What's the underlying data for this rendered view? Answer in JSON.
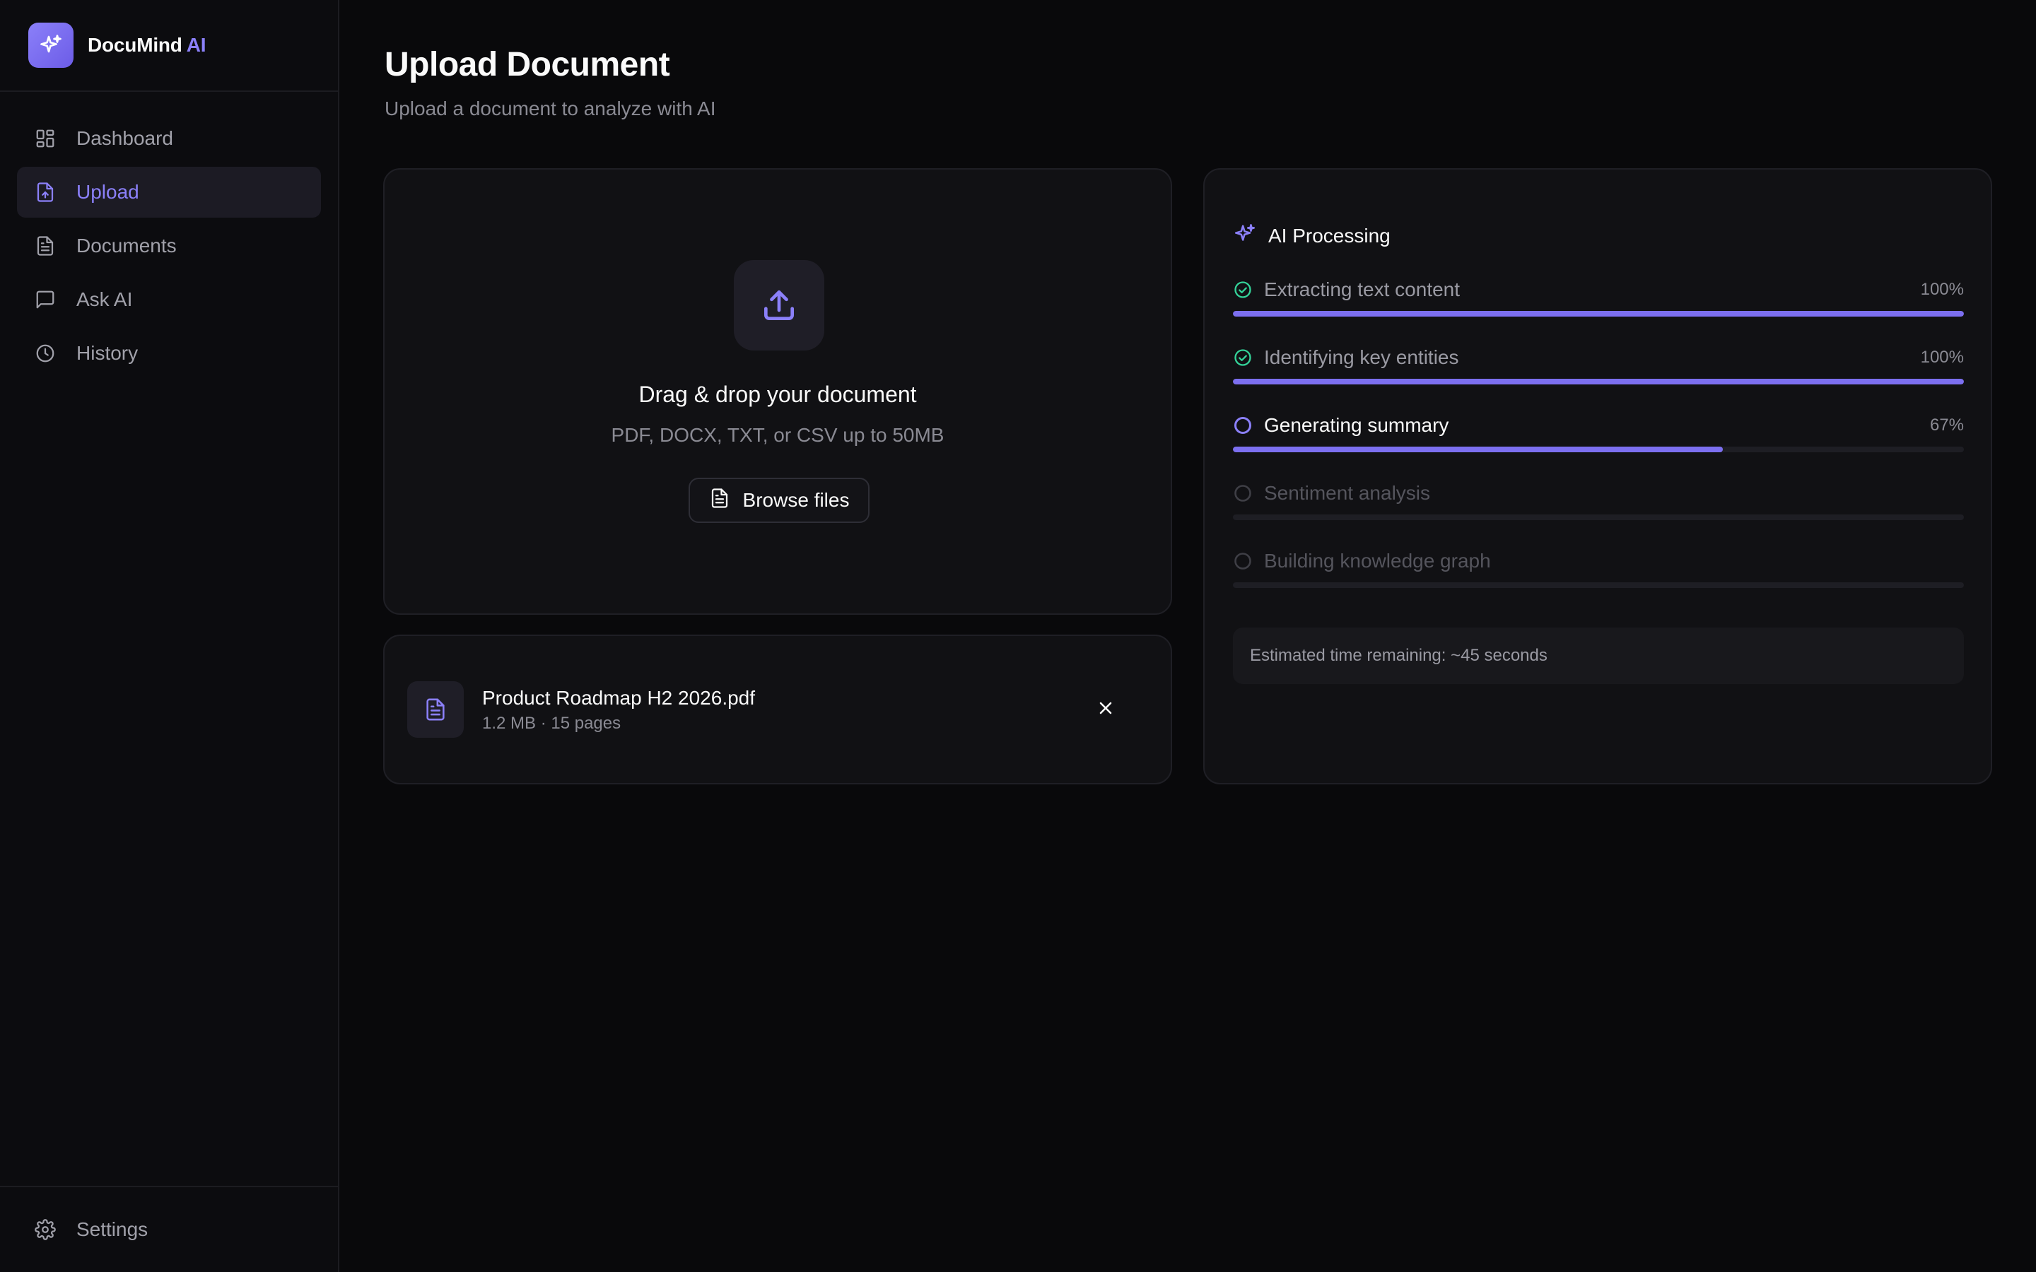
{
  "brand": {
    "name": "DocuMind",
    "accent": "AI",
    "accent_color": "#8b80f9",
    "logo_icon": "sparkles-icon"
  },
  "sidebar": {
    "items": [
      {
        "label": "Dashboard",
        "icon": "dashboard-icon",
        "active": false
      },
      {
        "label": "Upload",
        "icon": "file-upload-icon",
        "active": true
      },
      {
        "label": "Documents",
        "icon": "document-icon",
        "active": false
      },
      {
        "label": "Ask AI",
        "icon": "chat-icon",
        "active": false
      },
      {
        "label": "History",
        "icon": "clock-icon",
        "active": false
      }
    ],
    "settings": {
      "label": "Settings",
      "icon": "gear-icon"
    }
  },
  "page": {
    "title": "Upload Document",
    "subtitle": "Upload a document to analyze with AI"
  },
  "dropzone": {
    "icon": "upload-icon",
    "title": "Drag & drop your document",
    "subtitle": "PDF, DOCX, TXT, or CSV up to 50MB",
    "browse_label": "Browse files"
  },
  "file": {
    "name": "Product Roadmap H2 2026.pdf",
    "meta": "1.2 MB · 15 pages"
  },
  "processing": {
    "title": "AI Processing",
    "steps": [
      {
        "label": "Extracting text content",
        "status": "done",
        "pct_label": "100%",
        "progress": 1.0
      },
      {
        "label": "Identifying key entities",
        "status": "done",
        "pct_label": "100%",
        "progress": 1.0
      },
      {
        "label": "Generating summary",
        "status": "active",
        "pct_label": "67%",
        "progress": 0.67
      },
      {
        "label": "Sentiment analysis",
        "status": "pending",
        "pct_label": "",
        "progress": 0
      },
      {
        "label": "Building knowledge graph",
        "status": "pending",
        "pct_label": "",
        "progress": 0
      }
    ],
    "eta": "Estimated time remaining: ~45 seconds"
  },
  "colors": {
    "accent": "#7c6ff0",
    "success": "#34d399",
    "background": "#09090b"
  }
}
